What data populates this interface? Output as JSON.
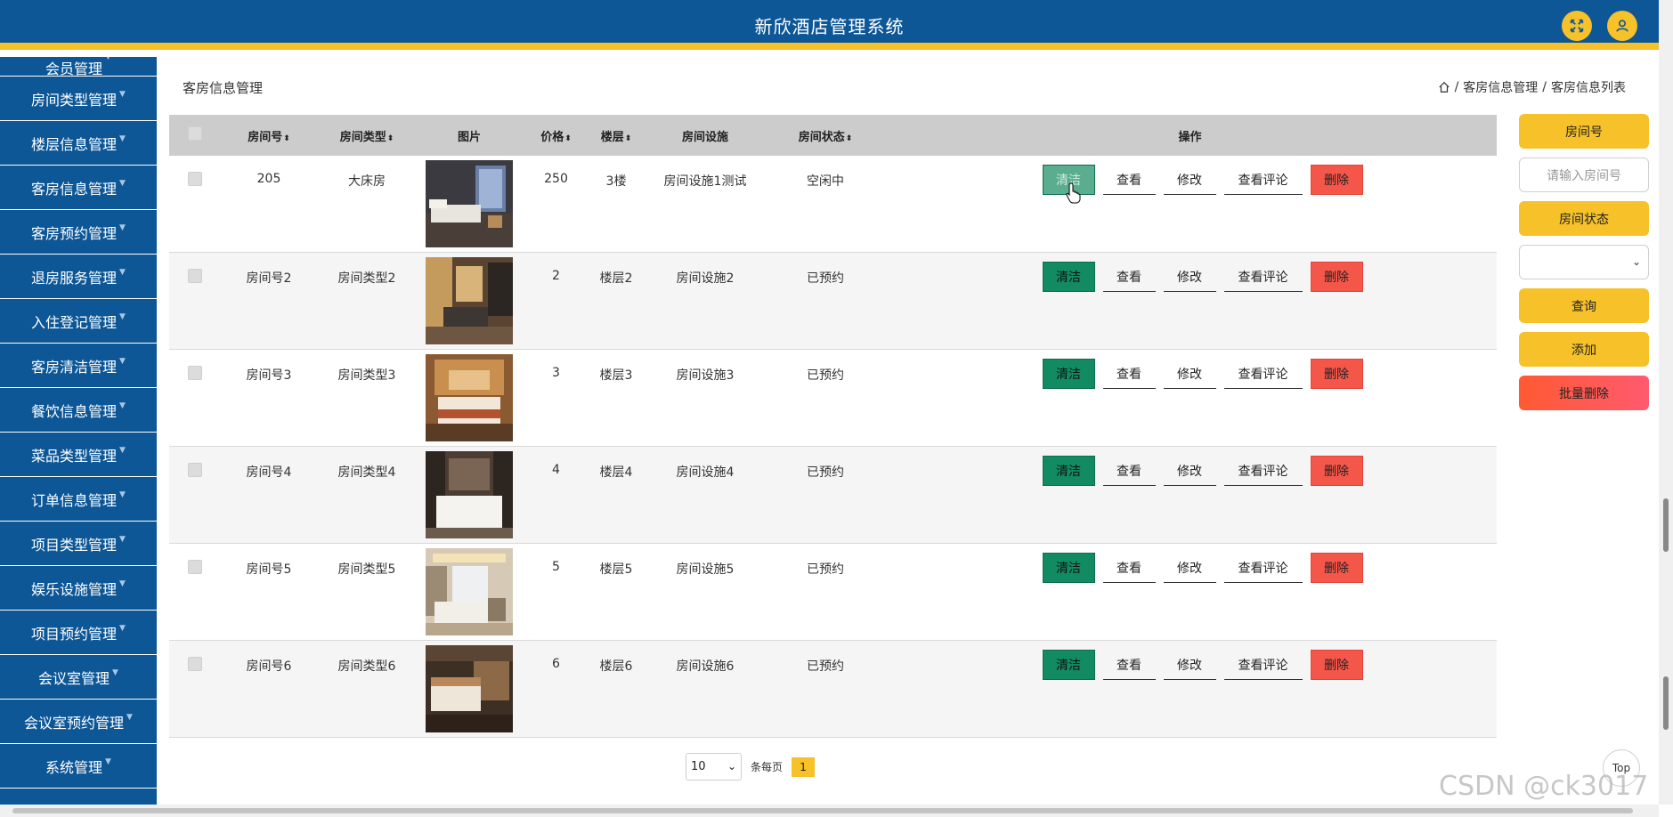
{
  "header": {
    "title": "新欣酒店管理系统"
  },
  "sidebar": {
    "items": [
      {
        "label": "会员管理"
      },
      {
        "label": "房间类型管理"
      },
      {
        "label": "楼层信息管理"
      },
      {
        "label": "客房信息管理"
      },
      {
        "label": "客房预约管理"
      },
      {
        "label": "退房服务管理"
      },
      {
        "label": "入住登记管理"
      },
      {
        "label": "客房清洁管理"
      },
      {
        "label": "餐饮信息管理"
      },
      {
        "label": "菜品类型管理"
      },
      {
        "label": "订单信息管理"
      },
      {
        "label": "项目类型管理"
      },
      {
        "label": "娱乐设施管理"
      },
      {
        "label": "项目预约管理"
      },
      {
        "label": "会议室管理"
      },
      {
        "label": "会议室预约管理"
      },
      {
        "label": "系统管理"
      }
    ]
  },
  "page": {
    "title": "客房信息管理",
    "breadcrumb": {
      "section": "客房信息管理",
      "current": "客房信息列表",
      "sep": "/"
    }
  },
  "table": {
    "headers": {
      "room_no": "房间号",
      "room_type": "房间类型",
      "image": "图片",
      "price": "价格",
      "floor": "楼层",
      "facilities": "房间设施",
      "status": "房间状态",
      "ops": "操作",
      "sort_glyph": "⬍"
    },
    "actions": {
      "clean": "清洁",
      "view": "查看",
      "edit": "修改",
      "reviews": "查看评论",
      "delete": "删除"
    },
    "rows": [
      {
        "room_no": "205",
        "room_type": "大床房",
        "price": "250",
        "floor": "3楼",
        "facilities": "房间设施1测试",
        "status": "空闲中"
      },
      {
        "room_no": "房间号2",
        "room_type": "房间类型2",
        "price": "2",
        "floor": "楼层2",
        "facilities": "房间设施2",
        "status": "已预约"
      },
      {
        "room_no": "房间号3",
        "room_type": "房间类型3",
        "price": "3",
        "floor": "楼层3",
        "facilities": "房间设施3",
        "status": "已预约"
      },
      {
        "room_no": "房间号4",
        "room_type": "房间类型4",
        "price": "4",
        "floor": "楼层4",
        "facilities": "房间设施4",
        "status": "已预约"
      },
      {
        "room_no": "房间号5",
        "room_type": "房间类型5",
        "price": "5",
        "floor": "楼层5",
        "facilities": "房间设施5",
        "status": "已预约"
      },
      {
        "room_no": "房间号6",
        "room_type": "房间类型6",
        "price": "6",
        "floor": "楼层6",
        "facilities": "房间设施6",
        "status": "已预约"
      }
    ]
  },
  "search": {
    "room_no_label": "房间号",
    "room_no_placeholder": "请输入房间号",
    "status_label": "房间状态",
    "query_label": "查询",
    "add_label": "添加",
    "batch_delete_label": "批量删除"
  },
  "pagination": {
    "page_size": "10",
    "per_page_label": "条每页",
    "current_page": "1"
  },
  "misc": {
    "top_label": "Top",
    "watermark": "CSDN @ck3017"
  },
  "colors": {
    "primary": "#0d5797",
    "accent": "#f6c129",
    "clean": "#128a62",
    "danger": "#f5564a"
  }
}
